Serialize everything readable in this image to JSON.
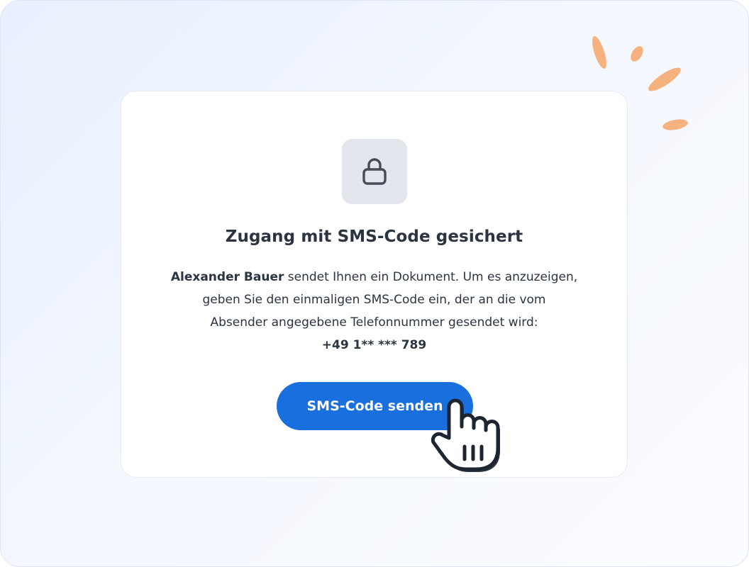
{
  "dialog": {
    "title": "Zugang mit SMS-Code gesichert",
    "sender_name": "Alexander Bauer",
    "message_line1": " sendet Ihnen ein Dokument. Um es anzuzeigen,",
    "message_line2": "geben Sie den einmaligen SMS-Code ein, der an die vom",
    "message_line3": "Absender angegebene Telefonnummer gesendet wird:",
    "phone_number": "+49 1** *** 789",
    "button_label": "SMS-Code senden",
    "icon": "lock-icon"
  },
  "colors": {
    "accent": "#1a6fdf",
    "sparkle": "#f6b27e",
    "text": "#2c3440",
    "icon_bg": "#e3e7ed"
  },
  "decor": {
    "cursor_icon": "hand-pointer-icon",
    "sparkle_icon": "sparkle-lines"
  }
}
